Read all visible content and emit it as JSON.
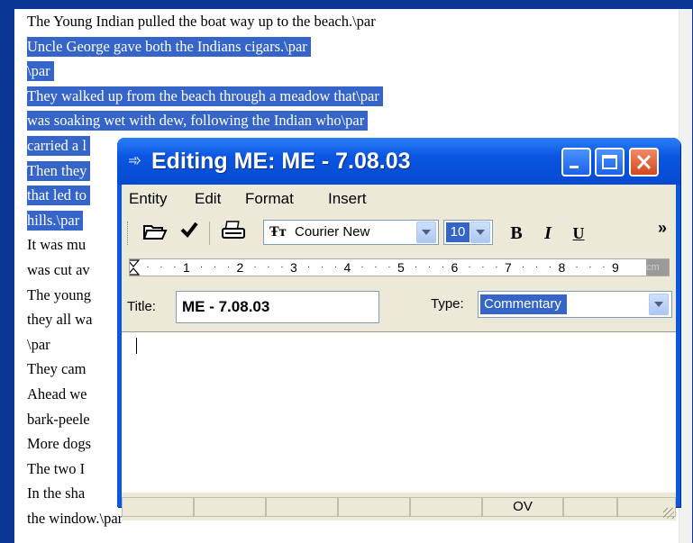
{
  "document": {
    "lines": [
      {
        "text": "The Young Indian pulled the boat way up to the beach.\\par",
        "selected": false
      },
      {
        "text": "Uncle George gave both the Indians cigars.\\par",
        "selected": true
      },
      {
        "text": "\\par",
        "selected": true
      },
      {
        "text": "They walked up from the beach through a meadow that\\par",
        "selected": true
      },
      {
        "text": "was soaking wet with dew, following the Indian who\\par",
        "selected": true
      },
      {
        "text": "carried a l",
        "selected": true
      },
      {
        "text": "Then they",
        "selected": true
      },
      {
        "text": "that led to",
        "selected": true
      },
      {
        "text": "hills.\\par",
        "selected": true
      },
      {
        "text": "It was mu",
        "selected": false
      },
      {
        "text": "was cut av",
        "selected": false
      },
      {
        "text": "The young",
        "selected": false
      },
      {
        "text": "they all wa",
        "selected": false
      },
      {
        "text": "\\par",
        "selected": false
      },
      {
        "text": "They cam",
        "selected": false
      },
      {
        "text": "Ahead we",
        "selected": false
      },
      {
        "text": "bark-peele",
        "selected": false
      },
      {
        "text": "More dogs",
        "selected": false
      },
      {
        "text": "The two I",
        "selected": false
      },
      {
        "text": "In the sha",
        "selected": false
      },
      {
        "text": "the window.\\par",
        "selected": false
      }
    ]
  },
  "dialog": {
    "title": "Editing ME: ME - 7.08.03",
    "menu": [
      "Entity",
      "Edit",
      "Format",
      "Insert"
    ],
    "toolbar": {
      "font_name": "Courier New",
      "font_icon": "Ŧт",
      "font_size": "10",
      "bold": "B",
      "italic": "I",
      "underline": "U",
      "overflow": "»"
    },
    "ruler": [
      "1",
      "2",
      "3",
      "4",
      "5",
      "6",
      "7",
      "8",
      "9"
    ],
    "ruler_end": "cm",
    "title_label": "Title:",
    "title_value": "ME - 7.08.03",
    "type_label": "Type:",
    "type_value": "Commentary",
    "status": {
      "ov": "OV"
    }
  },
  "colors": {
    "selection": "#3565c8",
    "titlebar": "#0a56e2",
    "desktop": "#0a3696"
  }
}
